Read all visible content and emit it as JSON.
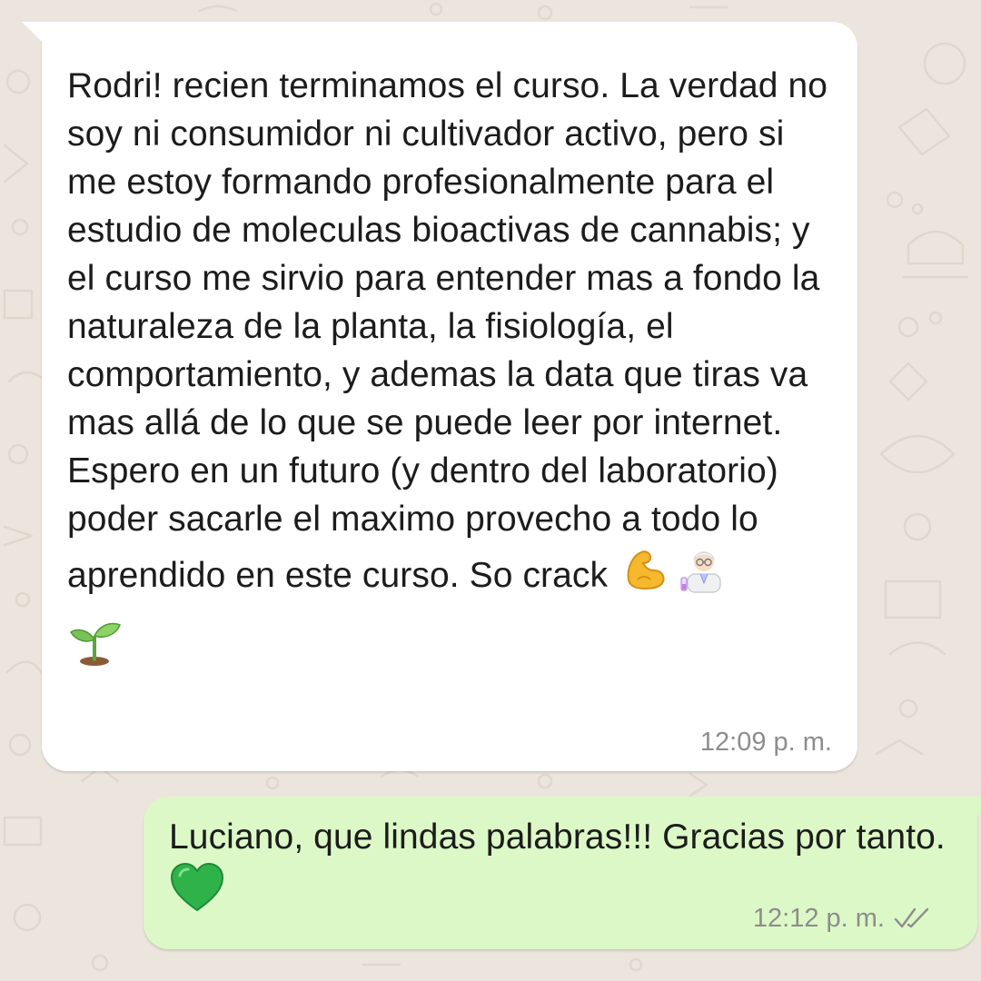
{
  "theme": {
    "wallpaper_color": "#ece5dd",
    "incoming_bubble_color": "#ffffff",
    "outgoing_bubble_color": "#dcf8c6",
    "timestamp_color": "#8d8d8d"
  },
  "messages": [
    {
      "direction": "incoming",
      "text": "Rodri! recien terminamos el curso. La verdad no soy ni consumidor ni cultivador activo, pero si me estoy formando profesionalmente para el estudio de moleculas bioactivas de cannabis; y el curso me sirvio para entender mas a fondo la naturaleza de la planta, la fisiología, el comportamiento, y ademas la data que tiras va mas allá de lo que se puede leer por internet. Espero en un futuro (y dentro del laboratorio) poder sacarle el maximo provecho a todo lo aprendido en este curso. So crack",
      "emojis": [
        "flexed-biceps-icon",
        "scientist-icon",
        "seedling-icon"
      ],
      "time": "12:09 p. m."
    },
    {
      "direction": "outgoing",
      "text": "Luciano, que lindas palabras!!! Gracias por tanto.",
      "emojis": [
        "green-heart-icon"
      ],
      "time": "12:12 p. m.",
      "status_icon": "double-check-icon"
    }
  ]
}
